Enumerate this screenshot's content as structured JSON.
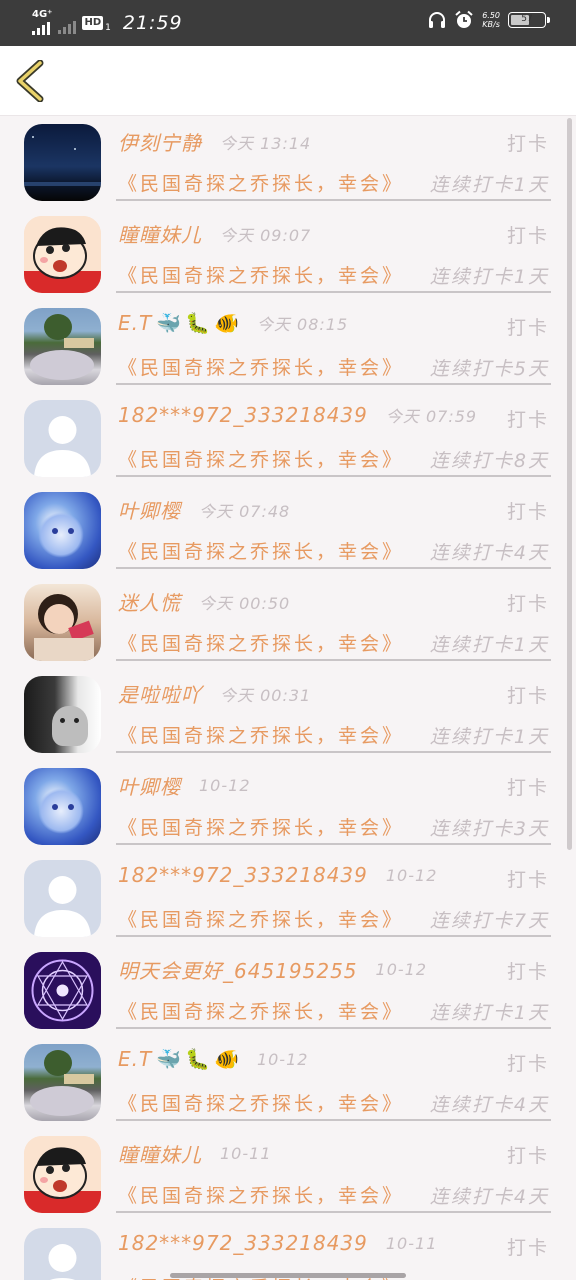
{
  "status_bar": {
    "network": "4G⁺",
    "hd": "HD",
    "sim": "1",
    "time": "21:59",
    "speed_value": "6.50",
    "speed_unit": "KB/s",
    "battery": "57",
    "battery_level": 0.57
  },
  "header": {
    "back_icon": "chevron-left-icon"
  },
  "checkin_label": "打卡",
  "book_title": "《民国奇探之乔探长，幸会》",
  "rows": [
    {
      "name": "伊刻宁静",
      "emojis": [],
      "time": "今天 13:14",
      "streak": "连续打卡1天",
      "avatar": "night-sky"
    },
    {
      "name": "瞳瞳妹儿",
      "emojis": [],
      "time": "今天 09:07",
      "streak": "连续打卡1天",
      "avatar": "cartoon-boy"
    },
    {
      "name": "E.T",
      "emojis": [
        "🐳",
        "🐛",
        "🐠"
      ],
      "time": "今天 08:15",
      "streak": "连续打卡5天",
      "avatar": "garden"
    },
    {
      "name": "182***972_333218439",
      "emojis": [],
      "time": "今天 07:59",
      "streak": "连续打卡8天",
      "avatar": "default-user"
    },
    {
      "name": "叶卿樱",
      "emojis": [],
      "time": "今天 07:48",
      "streak": "连续打卡4天",
      "avatar": "anime-girl"
    },
    {
      "name": "迷人慌",
      "emojis": [],
      "time": "今天 00:50",
      "streak": "连续打卡1天",
      "avatar": "little-girl"
    },
    {
      "name": "是啦啦吖",
      "emojis": [],
      "time": "今天 00:31",
      "streak": "连续打卡1天",
      "avatar": "cat"
    },
    {
      "name": "叶卿樱",
      "emojis": [],
      "time": "10-12",
      "streak": "连续打卡3天",
      "avatar": "anime-girl"
    },
    {
      "name": "182***972_333218439",
      "emojis": [],
      "time": "10-12",
      "streak": "连续打卡7天",
      "avatar": "default-user"
    },
    {
      "name": "明天会更好_645195255",
      "emojis": [],
      "time": "10-12",
      "streak": "连续打卡1天",
      "avatar": "magic-circle"
    },
    {
      "name": "E.T",
      "emojis": [
        "🐳",
        "🐛",
        "🐠"
      ],
      "time": "10-12",
      "streak": "连续打卡4天",
      "avatar": "garden"
    },
    {
      "name": "瞳瞳妹儿",
      "emojis": [],
      "time": "10-11",
      "streak": "连续打卡4天",
      "avatar": "cartoon-boy"
    },
    {
      "name": "182***972_333218439",
      "emojis": [],
      "time": "10-11",
      "streak": "",
      "avatar": "default-user"
    }
  ],
  "colors": {
    "accent": "#e79a61",
    "muted": "#c7bfc3",
    "background": "#f7f4f5",
    "status_bar": "#3c3c3c"
  }
}
